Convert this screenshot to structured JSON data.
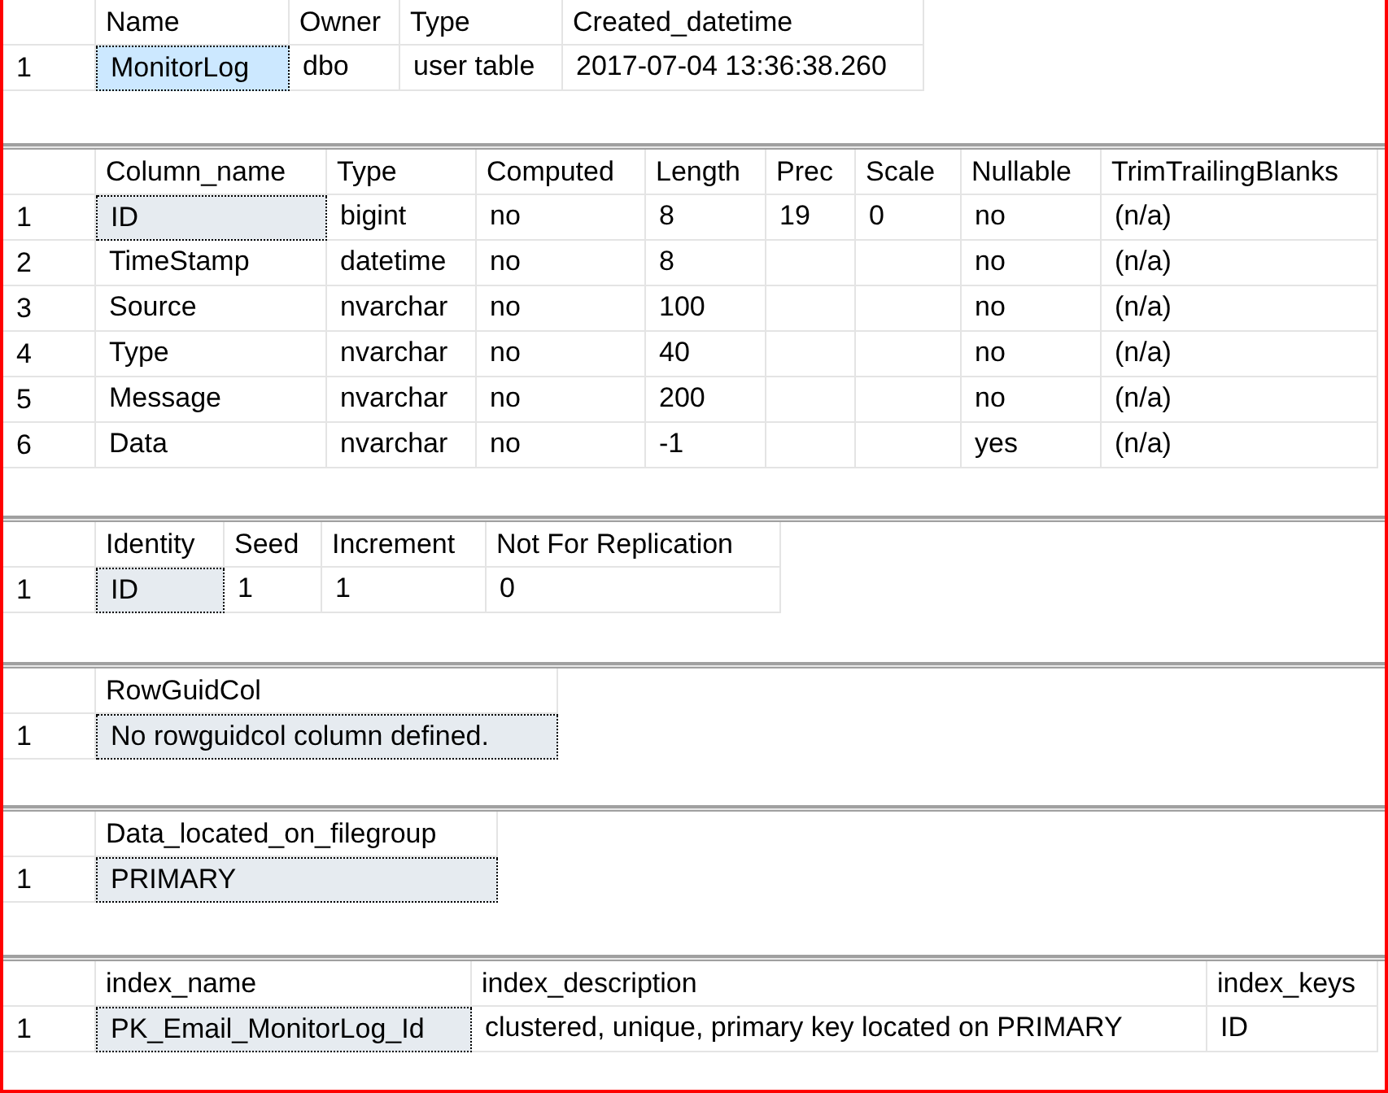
{
  "grids": [
    {
      "active": true,
      "columns": [
        "Name",
        "Owner",
        "Type",
        "Created_datetime"
      ],
      "rows": [
        {
          "number": "1",
          "cells": [
            "MonitorLog",
            "dbo",
            "user table",
            "2017-07-04 13:36:38.260"
          ]
        }
      ]
    },
    {
      "active": false,
      "columns": [
        "Column_name",
        "Type",
        "Computed",
        "Length",
        "Prec",
        "Scale",
        "Nullable",
        "TrimTrailingBlanks"
      ],
      "rows": [
        {
          "number": "1",
          "cells": [
            "ID",
            "bigint",
            "no",
            "8",
            "19",
            "0",
            "no",
            "(n/a)"
          ]
        },
        {
          "number": "2",
          "cells": [
            "TimeStamp",
            "datetime",
            "no",
            "8",
            null,
            null,
            "no",
            "(n/a)"
          ]
        },
        {
          "number": "3",
          "cells": [
            "Source",
            "nvarchar",
            "no",
            "100",
            null,
            null,
            "no",
            "(n/a)"
          ]
        },
        {
          "number": "4",
          "cells": [
            "Type",
            "nvarchar",
            "no",
            "40",
            null,
            null,
            "no",
            "(n/a)"
          ]
        },
        {
          "number": "5",
          "cells": [
            "Message",
            "nvarchar",
            "no",
            "200",
            null,
            null,
            "no",
            "(n/a)"
          ]
        },
        {
          "number": "6",
          "cells": [
            "Data",
            "nvarchar",
            "no",
            "-1",
            null,
            null,
            "yes",
            "(n/a)"
          ]
        }
      ]
    },
    {
      "active": false,
      "columns": [
        "Identity",
        "Seed",
        "Increment",
        "Not For Replication"
      ],
      "rows": [
        {
          "number": "1",
          "cells": [
            "ID",
            "1",
            "1",
            "0"
          ]
        }
      ]
    },
    {
      "active": false,
      "columns": [
        "RowGuidCol"
      ],
      "rows": [
        {
          "number": "1",
          "cells": [
            "No rowguidcol column defined."
          ]
        }
      ]
    },
    {
      "active": false,
      "columns": [
        "Data_located_on_filegroup"
      ],
      "rows": [
        {
          "number": "1",
          "cells": [
            "PRIMARY"
          ]
        }
      ]
    },
    {
      "active": false,
      "columns": [
        "index_name",
        "index_description",
        "index_keys"
      ],
      "rows": [
        {
          "number": "1",
          "cells": [
            "PK_Email_MonitorLog_Id",
            "clustered, unique, primary key located on PRIMARY",
            "ID"
          ]
        }
      ]
    }
  ]
}
